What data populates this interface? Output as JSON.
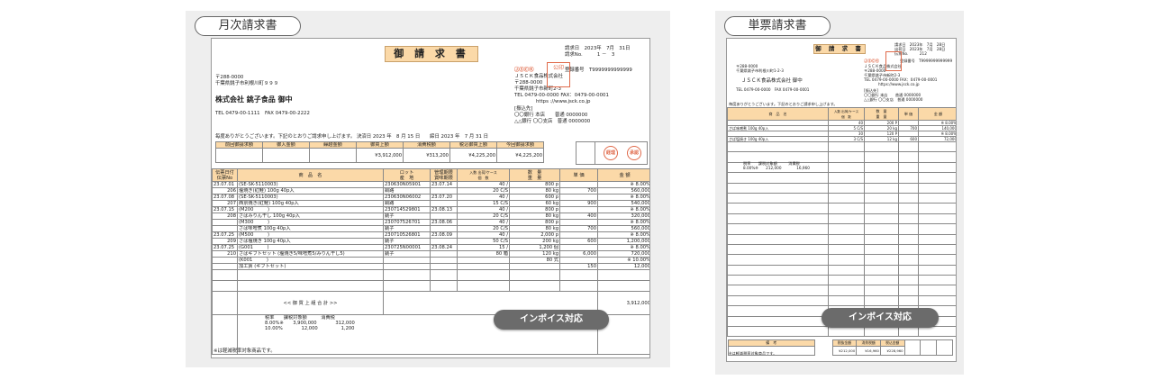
{
  "left": {
    "label": "月次請求書",
    "title": "御 請 求 書",
    "req_date": "請求日　2023年　7月　31日",
    "req_no": "請求No.　　　1 －　3",
    "reg_no": "登録番号　T9999999999999",
    "issuer": [
      "ＪＳＣＫ食品株式会社",
      "〒288-0000",
      "千葉県銚子市新町2-3",
      "TEL 0479-00-0000 FAX：0479-00-0001",
      "https ://www.jsck.co.jp"
    ],
    "bank": [
      "[振込先]",
      "〇〇銀行 本店　　普通 0000000",
      "△△銀行 〇〇支店　普通 0000000"
    ],
    "stamp_text": "公印",
    "recipient_zip": "〒288-0000",
    "recipient_addr": "千葉県銚子市利根川町９９９",
    "recipient_name": "株式会社 銚子食品 御中",
    "recipient_tel": "TEL 0479-00-1111　FAX 0479-00-2222",
    "greeting": "毎度ありがとうございます。下記のとおりご請求申し上げます。 決済日 2023 年　8 月 15 日　　締日 2023 年　7 月 31 日",
    "summary_headers": [
      "前回御請求額",
      "御入金額",
      "繰越金額",
      "御買上額",
      "消費税額",
      "税込御買上額",
      "今回御請求額"
    ],
    "summary_values": [
      "",
      "",
      "",
      "¥3,912,000",
      "¥313,200",
      "¥4,225,200",
      "¥4,225,200"
    ],
    "check_label": "経理",
    "approve_label": "承認",
    "item_headers": [
      "伝票日付\n伝票No",
      "商　品　名",
      "ロット\n産　地",
      "管理期限\n賞味期限",
      "入数 出荷/ケース\n個　数",
      "数　量\n重　量",
      "単 価",
      "金 額"
    ],
    "rows": [
      {
        "date": "23.07.01",
        "no": "206",
        "code": "(SE-SK-5110003)",
        "name": "塩焼き(紅鮭) 100g 40p入",
        "lot": "230630N05901",
        "origin": "銅路",
        "lim": "23.07.14",
        "qty1": "40 /",
        "qty2": "20 C/S",
        "amt1": "800 p",
        "amt2": "80 kg",
        "price": "700",
        "tax": "※ 8.00%",
        "total": "560,000"
      },
      {
        "date": "23.07.08",
        "no": "207",
        "code": "(SE-SK-5110003)",
        "name": "西京焼き(紅鮭) 100g 40p入",
        "lot": "230630N06002",
        "origin": "銅路",
        "lim": "23.07.20",
        "qty1": "40 /",
        "qty2": "15 C/S",
        "amt1": "600 p",
        "amt2": "60 kg",
        "price": "900",
        "tax": "※ 8.00%",
        "total": "540,000"
      },
      {
        "date": "23.07.15",
        "no": "208",
        "code": "(M200　　　)",
        "name": "さばみりん干し 100g 40p入",
        "lot": "230714529801",
        "origin": "銚子",
        "lim": "23.08.13",
        "qty1": "40 /",
        "qty2": "20 C/S",
        "amt1": "800 p",
        "amt2": "80 kg",
        "price": "400",
        "tax": "※ 8.00%",
        "total": "320,000"
      },
      {
        "date": "",
        "no": "",
        "code": "(M300　　　)",
        "name": "さば味噌煮 100g 40p入",
        "lot": "230707526701",
        "origin": "銚子",
        "lim": "23.08.06",
        "qty1": "40 /",
        "qty2": "20 C/S",
        "amt1": "800 p",
        "amt2": "80 kg",
        "price": "700",
        "tax": "※ 8.00%",
        "total": "560,000"
      },
      {
        "date": "23.07.25",
        "no": "209",
        "code": "(M500　　　)",
        "name": "さば塩焼き 100g 40p入",
        "lot": "230710526801",
        "origin": "銚子",
        "lim": "23.08.09",
        "qty1": "40 /",
        "qty2": "50 C/S",
        "amt1": "2,000 p",
        "amt2": "200 kg",
        "price": "600",
        "tax": "※ 8.00%",
        "total": "1,200,000"
      },
      {
        "date": "23.07.25",
        "no": "210",
        "code": "(G001　　　)",
        "name": "さばギフトセット (塩焼き5/味噌煮5/みりん干し5)",
        "lot": "230725N00001",
        "origin": "銚子",
        "lim": "23.08.24",
        "qty1": "15 /",
        "qty2": "80 箱",
        "amt1": "1,200 個",
        "amt2": "120 kg",
        "price": "6,000",
        "tax": "※ 8.00%",
        "total": "720,000"
      },
      {
        "date": "",
        "no": "",
        "code": "(K001　　　)",
        "name": "加工賃 (ギフトセット)",
        "lot": "",
        "origin": "",
        "lim": "",
        "qty1": "",
        "qty2": "",
        "amt1": "80 式",
        "amt2": "",
        "price": "150",
        "tax": "※ 10.00%",
        "total": "12,000"
      }
    ],
    "total_label": "<< 御 買 上 組 合 計 >>",
    "total_value": "3,912,000",
    "tax_headers": "税率　　課税対象額　　　消費税",
    "tax_row1": "8.00%※　　3,900,000　　　　312,000",
    "tax_row2": "10.00%　　　　12,000　　　　　1,200",
    "footnote": "※は軽減税率対象商品です。",
    "badge": "インボイス対応"
  },
  "right": {
    "label": "単票請求書",
    "title": "御 請 求 書",
    "req_info": [
      "請求日　2023年　7月　28日",
      "出荷日　2023年　7月　28日",
      "伝票No.　　　212"
    ],
    "reg_no": "登録番号　T9999999999999",
    "issuer": [
      "ＪＳＣＫ食品株式会社",
      "〒288-0000",
      "千葉県銚子市新町2-3",
      "TEL 0479-00-0000 FAX：0479-00-0001",
      "https://www.jsck.co.jp"
    ],
    "bank": [
      "[振込先]",
      "〇〇銀行 本店　　普通 0000000",
      "△△銀行 〇〇支店　普通 0000000"
    ],
    "recipient_zip": "〒288-0000",
    "recipient_addr": "千葉県銚子市利根川町1-2-3",
    "recipient_name": "ＪＳＣＫ食品株式会社 御中",
    "recipient_tel": "TEL 0479-00-0000　FAX 0479-00-0001",
    "greeting": "毎度ありがとうございます。下記のとおりご請求申し上げます。",
    "headers": [
      "商　品　名",
      "入数 出荷/ケース\n個　数",
      "数　量\n重　量",
      "単 価",
      "金 額"
    ],
    "rows": [
      {
        "name": "さば味噌煮 100g 40p入",
        "q1": "40",
        "q2": "5 C/S",
        "a1": "200 P",
        "a2": "20 kg",
        "price": "700",
        "tax": "※ 8.00%",
        "total": "140,000"
      },
      {
        "name": "さば塩焼き 100g 40p入",
        "q1": "30",
        "q2": "3 C/S",
        "a1": "120 P",
        "a2": "12 kg",
        "price": "600",
        "tax": "※ 8.00%",
        "total": "72,000"
      }
    ],
    "tax_line1": "税率　　課税対象額　　　消費税",
    "tax_line2": "8.00%※　　212,000　　　　16,960",
    "bottom_label": "備　考",
    "bottom_headers": [
      "税抜金額",
      "消費税額",
      "税込金額"
    ],
    "bottom_values": [
      "¥212,000",
      "¥16,960",
      "¥228,960"
    ],
    "footnote": "※は軽減税率対象商品です。",
    "badge": "インボイス対応"
  }
}
